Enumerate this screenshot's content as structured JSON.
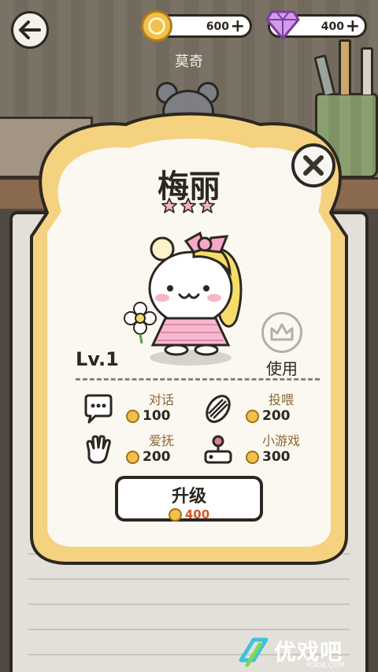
{
  "scene": {
    "npc_name": "莫奇"
  },
  "currency": {
    "coins": "600",
    "gems": "400",
    "plus": "+"
  },
  "character": {
    "name": "梅丽",
    "stars": 3,
    "level": "Lv.1",
    "use_label": "使用"
  },
  "actions": [
    {
      "label": "对话",
      "cost": "100",
      "icon": "speech-bubble-icon"
    },
    {
      "label": "投喂",
      "cost": "200",
      "icon": "sunflower-seed-icon"
    },
    {
      "label": "爱抚",
      "cost": "200",
      "icon": "hand-icon"
    },
    {
      "label": "小游戏",
      "cost": "300",
      "icon": "joystick-icon"
    }
  ],
  "upgrade": {
    "label": "升级",
    "cost": "400"
  },
  "watermark": {
    "text": "优戏吧",
    "sub": "YOXI8.COM"
  },
  "colors": {
    "bread_crust": "#f5d27f",
    "bread_inner": "#fbf8f1",
    "coin": "#f1c04a",
    "gem": "#c97ee0",
    "star": "#f3b3c4",
    "action_label": "#8a6732",
    "upgrade_cost": "#d0592a"
  }
}
